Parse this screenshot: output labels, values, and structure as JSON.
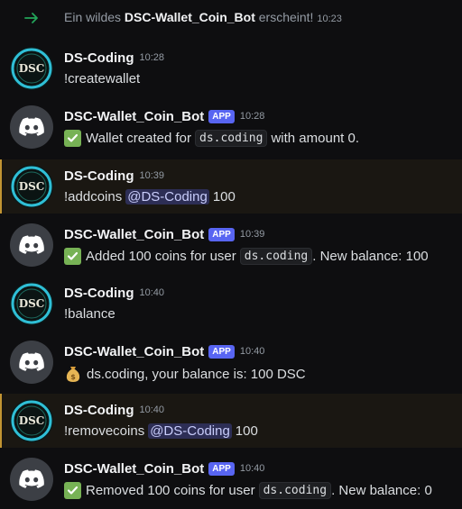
{
  "system_message": {
    "prefix": "Ein wildes",
    "bot_name": "DSC-Wallet_Coin_Bot",
    "suffix": "erscheint!",
    "time": "10:23"
  },
  "messages": [
    {
      "author": "DS-Coding",
      "time": "10:28",
      "text": "!createwallet"
    },
    {
      "author": "DSC-Wallet_Coin_Bot",
      "badge": "APP",
      "time": "10:28",
      "text_before": "Wallet created for",
      "code": "ds.coding",
      "text_after": "with amount 0."
    },
    {
      "author": "DS-Coding",
      "time": "10:39",
      "command": "!addcoins",
      "mention": "@DS-Coding",
      "amount": "100"
    },
    {
      "author": "DSC-Wallet_Coin_Bot",
      "badge": "APP",
      "time": "10:39",
      "text_before": "Added 100 coins for user",
      "code": "ds.coding",
      "text_after": ". New balance: 100"
    },
    {
      "author": "DS-Coding",
      "time": "10:40",
      "text": "!balance"
    },
    {
      "author": "DSC-Wallet_Coin_Bot",
      "badge": "APP",
      "time": "10:40",
      "text": "ds.coding, your balance is: 100 DSC"
    },
    {
      "author": "DS-Coding",
      "time": "10:40",
      "command": "!removecoins",
      "mention": "@DS-Coding",
      "amount": "100"
    },
    {
      "author": "DSC-Wallet_Coin_Bot",
      "badge": "APP",
      "time": "10:40",
      "text_before": "Removed 100 coins for user",
      "code": "ds.coding",
      "text_after": ". New balance: 0"
    }
  ],
  "colors": {
    "background": "#0e0e10",
    "highlight_bar": "#c29432",
    "app_badge": "#5865f2",
    "mention_text": "#c9cdfb",
    "check_green": "#77b255",
    "system_arrow": "#23a55a"
  },
  "icons": {
    "system": "arrow-right-icon",
    "bot_avatar": "discord-logo-icon",
    "user_avatar": "dsc-logo-icon",
    "success": "check-mark-icon",
    "balance": "money-bag-icon"
  }
}
